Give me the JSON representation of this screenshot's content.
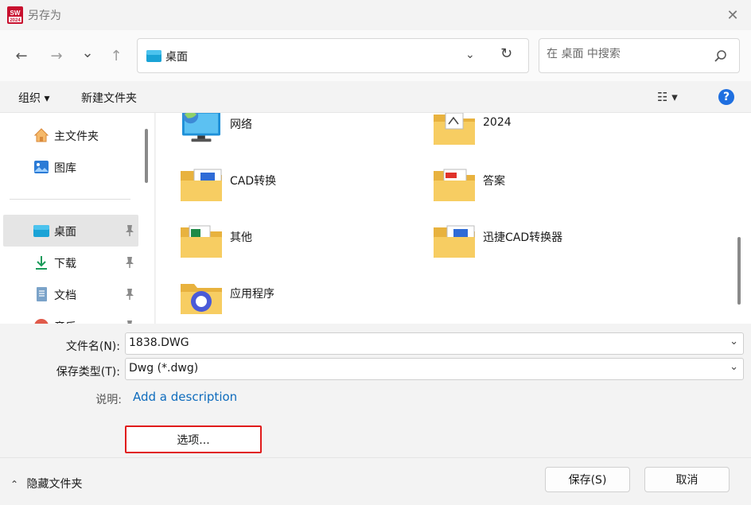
{
  "window": {
    "title": "另存为",
    "app_icon_text": "SW 2024",
    "close_glyph": "✕"
  },
  "nav": {
    "back_glyph": "←",
    "forward_glyph": "→",
    "recent_glyph": "⌄",
    "up_glyph": "↑",
    "address": "桌面",
    "address_dropdown_glyph": "⌄",
    "refresh_glyph": "↻",
    "search_placeholder": "在 桌面 中搜索"
  },
  "toolbar": {
    "organize_label": "组织 ▾",
    "new_folder_label": "新建文件夹",
    "view_glyph": "☷ ▾",
    "help_glyph": "?"
  },
  "sidebar": {
    "items": [
      {
        "label": "主文件夹",
        "icon": "home-icon",
        "pinned": false
      },
      {
        "label": "图库",
        "icon": "gallery-icon",
        "pinned": false
      },
      {
        "label": "桌面",
        "icon": "desktop-icon",
        "pinned": true,
        "selected": true
      },
      {
        "label": "下载",
        "icon": "download-icon",
        "pinned": true
      },
      {
        "label": "文档",
        "icon": "document-icon",
        "pinned": true
      },
      {
        "label": "音乐",
        "icon": "music-icon",
        "pinned": true
      }
    ],
    "pin_glyph": "📌"
  },
  "files": [
    {
      "name": "网络",
      "icon": "network-icon"
    },
    {
      "name": "2024",
      "icon": "folder-icon"
    },
    {
      "name": "CAD转换",
      "icon": "folder-icon"
    },
    {
      "name": "答案",
      "icon": "folder-icon"
    },
    {
      "name": "其他",
      "icon": "folder-icon"
    },
    {
      "name": "迅捷CAD转换器",
      "icon": "folder-icon"
    },
    {
      "name": "应用程序",
      "icon": "folder-icon"
    }
  ],
  "form": {
    "filename_label": "文件名(N):",
    "filename_value": "1838.DWG",
    "filetype_label": "保存类型(T):",
    "filetype_value": "Dwg (*.dwg)",
    "description_label": "说明:",
    "description_link": "Add a description",
    "options_label": "选项...",
    "chevron_glyph": "⌄"
  },
  "footer": {
    "hide_folders_label": "隐藏文件夹",
    "hide_chevron_glyph": "⌃",
    "save_label": "保存(S)",
    "cancel_label": "取消"
  },
  "colors": {
    "accent": "#0f6cbd",
    "highlight_border": "#e01b1b",
    "folder_yellow": "#f5c95a",
    "help_blue": "#1f6fe0"
  }
}
